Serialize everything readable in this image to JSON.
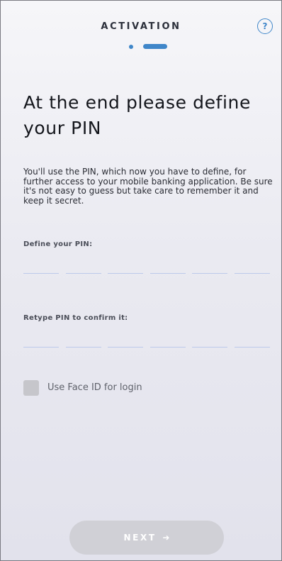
{
  "header": {
    "title": "ACTIVATION",
    "help_icon": "?"
  },
  "progress": {
    "current_step": 2,
    "total_steps": 2
  },
  "content": {
    "heading": "At the end please define your PIN",
    "description": "You'll use the PIN, which now you have to define, for further access to your mobile banking application. Be sure it's not easy to guess but take care to remember it and keep it secret."
  },
  "pin_fields": {
    "define_label": "Define your PIN:",
    "confirm_label": "Retype PIN to confirm it:",
    "digits": 6
  },
  "face_id": {
    "label": "Use Face ID for login",
    "checked": false
  },
  "footer": {
    "next_label": "NEXT",
    "next_icon": "➜",
    "next_enabled": false
  },
  "colors": {
    "accent": "#3f86c9",
    "pin_underline": "#bcc9ea",
    "disabled_button": "#d0d0d6",
    "checkbox": "#c6c6cb"
  },
  "icons": {
    "help": "help-icon",
    "next_arrow": "arrow-right-icon"
  }
}
